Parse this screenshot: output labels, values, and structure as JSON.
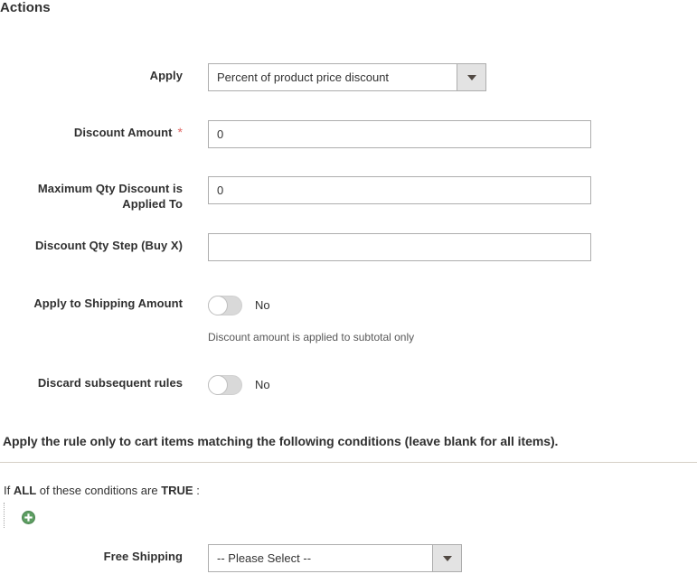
{
  "section": {
    "title": "Actions"
  },
  "fields": {
    "apply": {
      "label": "Apply",
      "value": "Percent of product price discount",
      "arrow_icon": "chevron-down-icon"
    },
    "discount_amount": {
      "label": "Discount Amount",
      "required_marker": "*",
      "value": "0"
    },
    "max_qty": {
      "label_line1": "Maximum Qty Discount is",
      "label_line2": "Applied To",
      "value": "0"
    },
    "discount_qty_step": {
      "label": "Discount Qty Step (Buy X)",
      "value": "",
      "placeholder": ""
    },
    "apply_to_shipping": {
      "label": "Apply to Shipping Amount",
      "toggle_state": "No",
      "helper": "Discount amount is applied to subtotal only"
    },
    "discard_subsequent": {
      "label": "Discard subsequent rules",
      "toggle_state": "No"
    }
  },
  "conditions": {
    "heading": "Apply the rule only to cart items matching the following conditions (leave blank for all items).",
    "sentence_prefix": "If",
    "aggregator": "ALL",
    "sentence_middle": "of these conditions are",
    "value_true": "TRUE",
    "sentence_suffix": ":",
    "add_icon": "plus-circle-icon",
    "free_shipping": {
      "label": "Free Shipping",
      "value": "-- Please Select --",
      "arrow_icon": "chevron-down-icon"
    }
  },
  "colors": {
    "text": "#303030",
    "required": "#e06461",
    "divider": "#d6d0c6",
    "add_green": "#5d9e62",
    "toggle_track": "#d9d9d9"
  }
}
